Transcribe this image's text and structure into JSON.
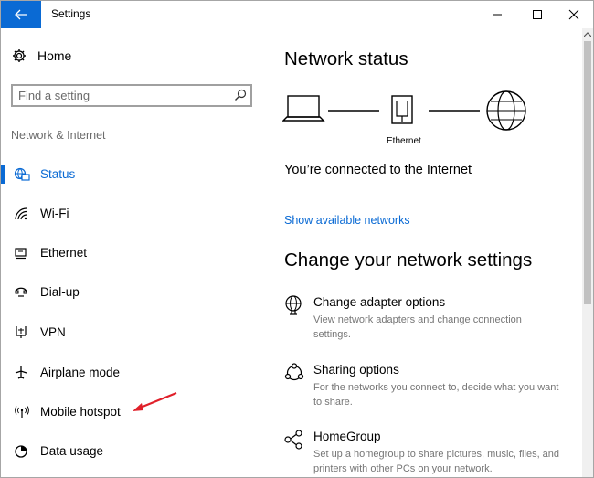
{
  "window": {
    "title": "Settings"
  },
  "sidebar": {
    "home_label": "Home",
    "search_placeholder": "Find a setting",
    "section_label": "Network & Internet",
    "items": [
      {
        "label": "Status",
        "icon": "globe-monitor-icon",
        "active": true
      },
      {
        "label": "Wi-Fi",
        "icon": "wifi-icon",
        "active": false
      },
      {
        "label": "Ethernet",
        "icon": "ethernet-icon",
        "active": false
      },
      {
        "label": "Dial-up",
        "icon": "dialup-icon",
        "active": false
      },
      {
        "label": "VPN",
        "icon": "vpn-icon",
        "active": false
      },
      {
        "label": "Airplane mode",
        "icon": "airplane-icon",
        "active": false
      },
      {
        "label": "Mobile hotspot",
        "icon": "hotspot-icon",
        "active": false
      },
      {
        "label": "Data usage",
        "icon": "data-usage-icon",
        "active": false
      }
    ]
  },
  "main": {
    "network_status_title": "Network status",
    "diagram_label": "Ethernet",
    "connected_text": "You’re connected to the Internet",
    "show_networks_link": "Show available networks",
    "change_settings_title": "Change your network settings",
    "options": [
      {
        "title": "Change adapter options",
        "desc": "View network adapters and change connection settings.",
        "icon": "adapter-globe-icon"
      },
      {
        "title": "Sharing options",
        "desc": "For the networks you connect to, decide what you want to share.",
        "icon": "sharing-icon"
      },
      {
        "title": "HomeGroup",
        "desc": "Set up a homegroup to share pictures, music, files, and printers with other PCs on your network.",
        "icon": "homegroup-icon"
      }
    ]
  },
  "colors": {
    "accent": "#0a6ad4",
    "annotation_arrow": "#e0202a"
  }
}
